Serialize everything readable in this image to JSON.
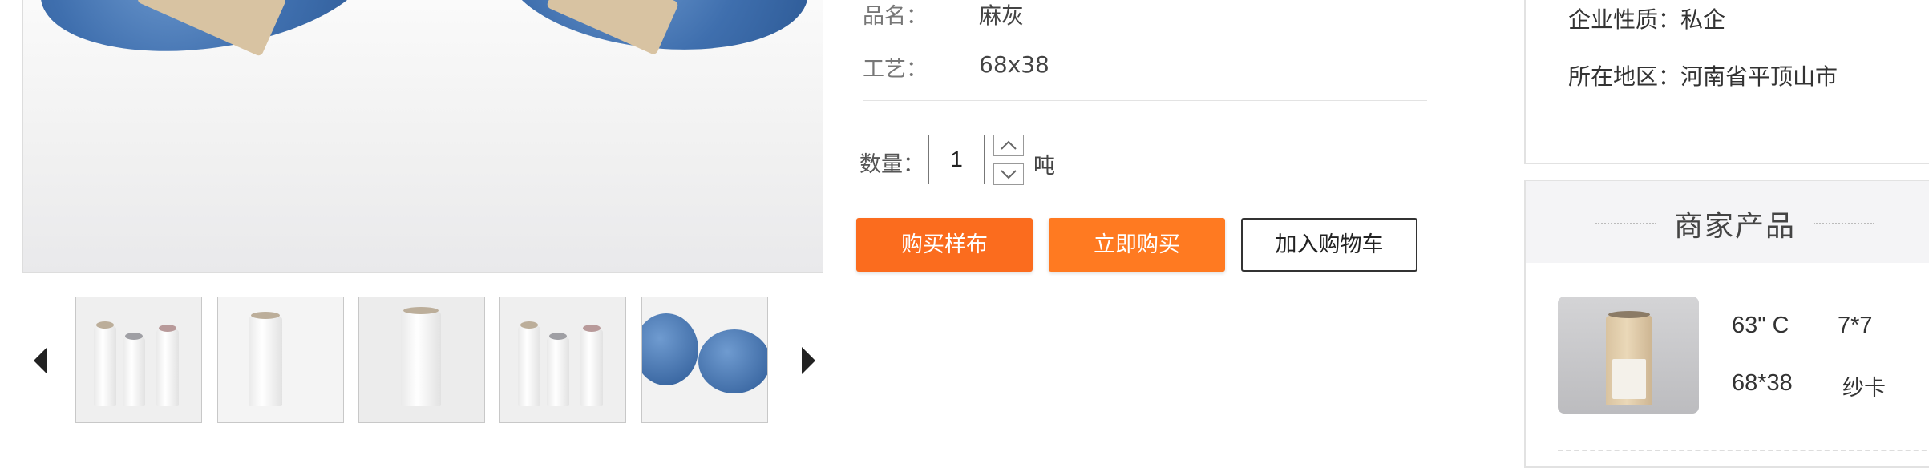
{
  "specs": [
    {
      "label": "品名：",
      "value": "麻灰"
    },
    {
      "label": "工艺：",
      "value": "68x38"
    }
  ],
  "quantity": {
    "label": "数量：",
    "value": "1",
    "unit": "吨"
  },
  "buttons": {
    "sample": "购买样布",
    "buy_now": "立即购买",
    "add_to_cart": "加入购物车"
  },
  "company": {
    "nature": "企业性质：私企",
    "region": "所在地区：河南省平顶山市"
  },
  "merchant_products": {
    "title": "商家产品",
    "items": [
      {
        "spec_a": "63\" C",
        "spec_b": "7*7",
        "spec_c": "68*38",
        "spec_d": "纱卡"
      }
    ]
  },
  "colors": {
    "primary_orange": "#fb6c1e",
    "buy_orange": "#ff7a21",
    "yarn_blue": "#3f6fae"
  },
  "icons": [
    "arrow-left-icon",
    "arrow-right-icon",
    "chevron-up-icon",
    "chevron-down-icon"
  ]
}
